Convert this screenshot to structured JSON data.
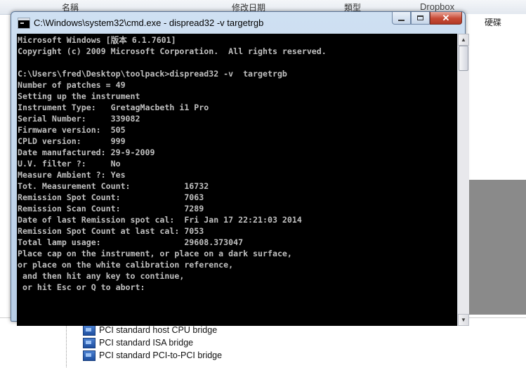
{
  "background": {
    "header_col1": "名稱",
    "header_col2": "修改日期",
    "header_col3": "類型",
    "dropbox_label": "Dropbox",
    "right_label": "硬碟",
    "tree_items": [
      {
        "label": "PCI standard host CPU bridge",
        "icon": "pci-device-icon"
      },
      {
        "label": "PCI standard ISA bridge",
        "icon": "pci-device-icon"
      },
      {
        "label": "PCI standard PCI-to-PCI bridge",
        "icon": "pci-device-icon"
      }
    ]
  },
  "window": {
    "title": "C:\\Windows\\system32\\cmd.exe - dispread32  -v  targetrgb",
    "icon": "cmd-icon",
    "buttons": {
      "minimize": "minimize",
      "maximize": "maximize",
      "close": "✕"
    }
  },
  "console": {
    "lines": [
      "Microsoft Windows [版本 6.1.7601]",
      "Copyright (c) 2009 Microsoft Corporation.  All rights reserved.",
      "",
      "C:\\Users\\fred\\Desktop\\toolpack>dispread32 -v  targetrgb",
      "Number of patches = 49",
      "Setting up the instrument",
      "Instrument Type:   GretagMacbeth i1 Pro",
      "Serial Number:     339082",
      "Firmware version:  505",
      "CPLD version:      999",
      "Date manufactured: 29-9-2009",
      "U.V. filter ?:     No",
      "Measure Ambient ?: Yes",
      "Tot. Measurement Count:           16732",
      "Remission Spot Count:             7063",
      "Remission Scan Count:             7289",
      "Date of last Remission spot cal:  Fri Jan 17 22:21:03 2014",
      "Remission Spot Count at last cal: 7053",
      "Total lamp usage:                 29608.373047",
      "Place cap on the instrument, or place on a dark surface,",
      "or place on the white calibration reference,",
      " and then hit any key to continue,",
      " or hit Esc or Q to abort:"
    ]
  }
}
